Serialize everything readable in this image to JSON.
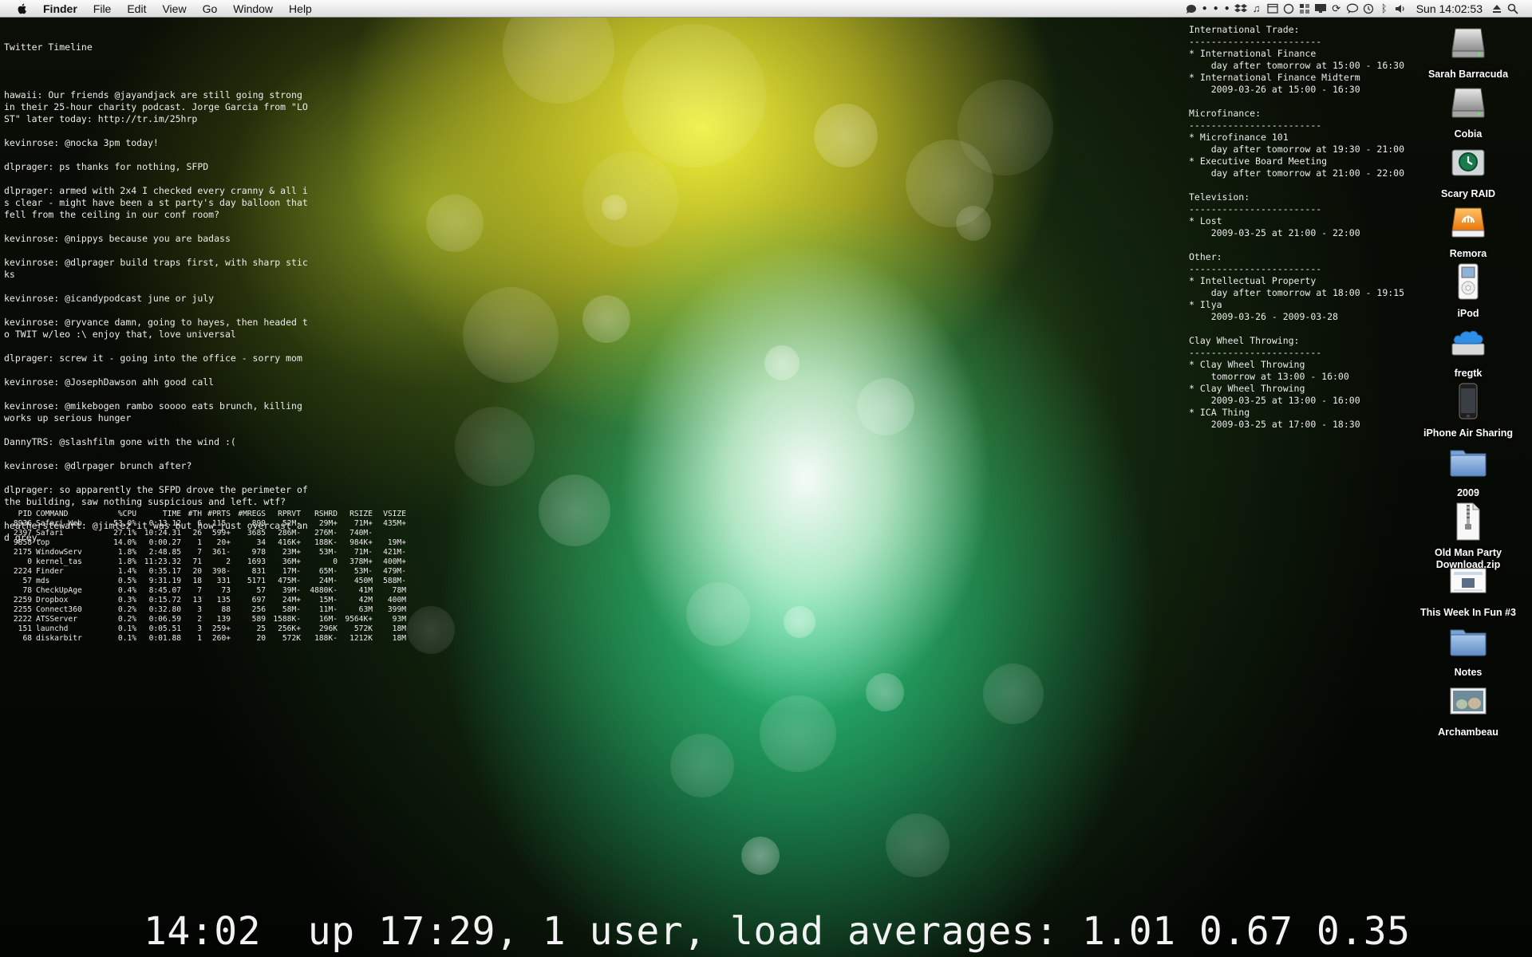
{
  "menubar": {
    "app_name": "Finder",
    "menus": [
      "File",
      "Edit",
      "View",
      "Go",
      "Window",
      "Help"
    ],
    "clock": "Sun 14:02:53"
  },
  "twitter": {
    "title": "Twitter Timeline",
    "tweets": [
      "hawaii: Our friends @jayandjack are still going strong in their 25-hour charity podcast. Jorge Garcia from \"LOST\" later today: http://tr.im/25hrp",
      "kevinrose: @nocka 3pm today!",
      "dlprager: ps thanks for nothing, SFPD",
      "dlprager: armed with 2x4 I checked every cranny & all is clear - might have been a st party's day balloon that fell from the ceiling in our conf room?",
      "kevinrose: @nippys because you are badass",
      "kevinrose: @dlprager build traps first, with sharp sticks",
      "kevinrose: @icandypodcast june or july",
      "kevinrose: @ryvance damn, going to hayes, then headed to TWIT w/leo :\\ enjoy that, love universal",
      "dlprager: screw it - going into the office - sorry mom",
      "kevinrose: @JosephDawson ahh good call",
      "kevinrose: @mikebogen rambo soooo eats brunch, killing works up serious hunger",
      "DannyTRS: @slashfilm gone with the wind :(",
      "kevinrose: @dlrpager brunch after?",
      "dlprager: so apparently the SFPD drove the perimeter of the building, saw nothing suspicious and left. wtf?",
      "heatherstewart: @jimtez it was but now just overcast and grey."
    ]
  },
  "top": {
    "columns": [
      "PID",
      "COMMAND",
      "%CPU",
      "TIME",
      "#TH",
      "#PRTS",
      "#MREGS",
      "RPRVT",
      "RSHRD",
      "RSIZE",
      "VSIZE"
    ],
    "rows": [
      [
        "8936",
        "Safari Web",
        "53.0%",
        "0:13.12",
        "6",
        "115-",
        "899",
        "52M-",
        "29M+",
        "71M+",
        "435M+"
      ],
      [
        "2397",
        "Safari",
        "27.1%",
        "10:24.31",
        "26",
        "599+",
        "3685",
        "286M-",
        "276M-",
        "740M-",
        ""
      ],
      [
        "9858",
        "top",
        "14.0%",
        "0:00.27",
        "1",
        "20+",
        "34",
        "416K+",
        "188K-",
        "984K+",
        "19M+"
      ],
      [
        "2175",
        "WindowServ",
        "1.8%",
        "2:48.85",
        "7",
        "361-",
        "978",
        "23M+",
        "53M-",
        "71M-",
        "421M-"
      ],
      [
        "0",
        "kernel_tas",
        "1.8%",
        "11:23.32",
        "71",
        "2",
        "1693",
        "36M+",
        "0",
        "378M+",
        "400M+"
      ],
      [
        "2224",
        "Finder",
        "1.4%",
        "0:35.17",
        "20",
        "398-",
        "831",
        "17M-",
        "65M-",
        "53M-",
        "479M-"
      ],
      [
        "57",
        "mds",
        "0.5%",
        "9:31.19",
        "18",
        "331",
        "5171",
        "475M-",
        "24M-",
        "450M",
        "588M-"
      ],
      [
        "78",
        "CheckUpAge",
        "0.4%",
        "8:45.07",
        "7",
        "73",
        "57",
        "39M-",
        "4880K-",
        "41M",
        "78M"
      ],
      [
        "2259",
        "Dropbox",
        "0.3%",
        "0:15.72",
        "13",
        "135",
        "697",
        "24M+",
        "15M-",
        "42M",
        "400M"
      ],
      [
        "2255",
        "Connect360",
        "0.2%",
        "0:32.80",
        "3",
        "88",
        "256",
        "58M-",
        "11M-",
        "63M",
        "399M"
      ],
      [
        "2222",
        "ATSServer",
        "0.2%",
        "0:06.59",
        "2",
        "139",
        "589",
        "1588K-",
        "16M-",
        "9564K+",
        "93M"
      ],
      [
        "151",
        "launchd",
        "0.1%",
        "0:05.51",
        "3",
        "259+",
        "25",
        "256K+",
        "296K",
        "572K",
        "18M"
      ],
      [
        "68",
        "diskarbitr",
        "0.1%",
        "0:01.88",
        "1",
        "260+",
        "20",
        "572K",
        "188K-",
        "1212K",
        "18M"
      ]
    ]
  },
  "calendar": {
    "separator": "------------------------",
    "categories": [
      {
        "name": "International Trade:",
        "events": [
          {
            "title": "* International Finance",
            "when": "    day after tomorrow at 15:00 - 16:30"
          },
          {
            "title": "* International Finance Midterm",
            "when": "    2009-03-26 at 15:00 - 16:30"
          }
        ]
      },
      {
        "name": "Microfinance:",
        "events": [
          {
            "title": "* Microfinance 101",
            "when": "    day after tomorrow at 19:30 - 21:00"
          },
          {
            "title": "* Executive Board Meeting",
            "when": "    day after tomorrow at 21:00 - 22:00"
          }
        ]
      },
      {
        "name": "Television:",
        "events": [
          {
            "title": "* Lost",
            "when": "    2009-03-25 at 21:00 - 22:00"
          }
        ]
      },
      {
        "name": "Other:",
        "events": [
          {
            "title": "* Intellectual Property",
            "when": "    day after tomorrow at 18:00 - 19:15"
          },
          {
            "title": "* Ilya",
            "when": "    2009-03-26 - 2009-03-28"
          }
        ]
      },
      {
        "name": "Clay Wheel Throwing:",
        "events": [
          {
            "title": "* Clay Wheel Throwing",
            "when": "    tomorrow at 13:00 - 16:00"
          },
          {
            "title": "* Clay Wheel Throwing",
            "when": "    2009-03-25 at 13:00 - 16:00"
          },
          {
            "title": "* ICA Thing",
            "when": "    2009-03-25 at 17:00 - 18:30"
          }
        ]
      }
    ]
  },
  "uptime": "14:02  up 17:29, 1 user, load averages: 1.01 0.67 0.35",
  "desktop_icons": [
    {
      "label": "Sarah Barracuda",
      "icon": "hard-drive-icon"
    },
    {
      "label": "Cobia",
      "icon": "hard-drive-icon"
    },
    {
      "label": "Scary RAID",
      "icon": "time-machine-drive-icon"
    },
    {
      "label": "Remora",
      "icon": "firewire-drive-icon"
    },
    {
      "label": "iPod",
      "icon": "ipod-icon"
    },
    {
      "label": "fregtk",
      "icon": "idisk-icon"
    },
    {
      "label": "iPhone Air Sharing",
      "icon": "iphone-icon"
    },
    {
      "label": "2009",
      "icon": "folder-icon"
    },
    {
      "label": "Old Man Party Download.zip",
      "icon": "zip-file-icon"
    },
    {
      "label": "This Week In Fun #3",
      "icon": "document-thumbnail-icon"
    },
    {
      "label": "Notes",
      "icon": "folder-icon"
    },
    {
      "label": "Archambeau",
      "icon": "photo-thumbnail-icon"
    }
  ],
  "status_icons": [
    "growl-icon",
    "dropbox-icon",
    "itunes-icon",
    "calendar-icon",
    "activity-icon",
    "spaces-icon",
    "display-icon",
    "sync-icon",
    "ichat-icon",
    "time-machine-icon",
    "bluetooth-icon",
    "volume-icon",
    "eject-icon",
    "spotlight-icon"
  ]
}
